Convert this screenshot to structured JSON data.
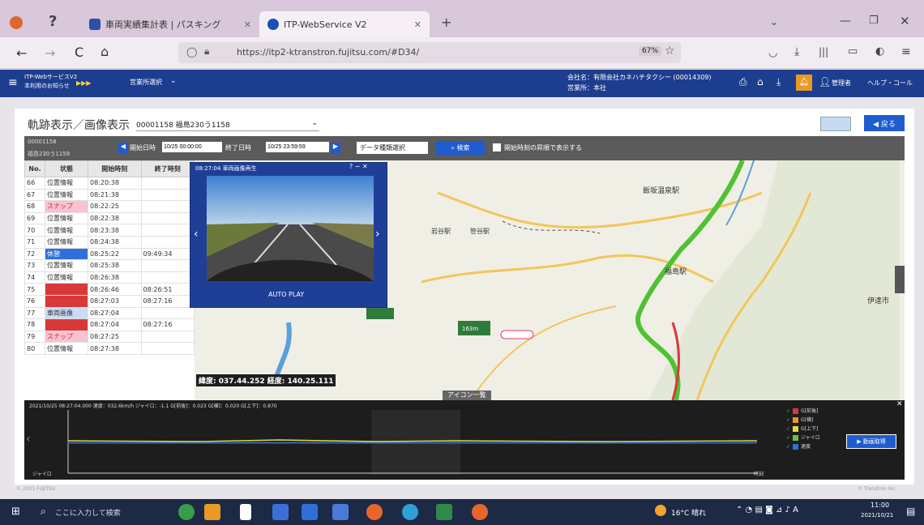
{
  "browser": {
    "tabs": [
      {
        "label": "車両実績集計表 | パスキング"
      },
      {
        "label": "ITP-WebService V2"
      }
    ],
    "url": "https://itp2-ktranstron.fujitsu.com/#D34/",
    "zoom": "67%"
  },
  "app_header": {
    "left_text_1": "ITP-WebサービスV2",
    "left_text_2": "本利用のお知らせ",
    "menu": "営業所選択",
    "company": "会社名：有限会社カネハチタクシー (00014309)",
    "office": "営業所：本社",
    "user": "管理者",
    "help": "ヘルプ・コール"
  },
  "page": {
    "title": "軌跡表示／画像表示",
    "vehicle_select": "00001158 福島230う1158",
    "back_button": "戻る"
  },
  "toolbar": {
    "vehicle_id": "00001158",
    "vehicle_plate": "福島230う1158",
    "start_label": "開始日時",
    "start_value": "10/25 00:00:00",
    "end_label": "終了日時",
    "end_value": "10/25 23:59:59",
    "data_select": "データ種類選択",
    "search": "検索",
    "checkbox_label": "開始時刻の昇順で表示する"
  },
  "table": {
    "headers": [
      "No.",
      "状態",
      "開始時刻",
      "終了時刻"
    ],
    "rows": [
      {
        "no": "66",
        "status": "位置情報",
        "start": "08:20:38",
        "end": "",
        "color": ""
      },
      {
        "no": "67",
        "status": "位置情報",
        "start": "08:21:38",
        "end": "",
        "color": ""
      },
      {
        "no": "68",
        "status": "スナップ",
        "start": "08:22:25",
        "end": "",
        "color": "#f7c3d3"
      },
      {
        "no": "69",
        "status": "位置情報",
        "start": "08:22:38",
        "end": "",
        "color": ""
      },
      {
        "no": "70",
        "status": "位置情報",
        "start": "08:23:38",
        "end": "",
        "color": ""
      },
      {
        "no": "71",
        "status": "位置情報",
        "start": "08:24:38",
        "end": "",
        "color": ""
      },
      {
        "no": "72",
        "status": "休憩",
        "start": "08:25:22",
        "end": "09:49:34",
        "color": "#2f6fd8"
      },
      {
        "no": "73",
        "status": "位置情報",
        "start": "08:25:38",
        "end": "",
        "color": ""
      },
      {
        "no": "74",
        "status": "位置情報",
        "start": "08:26:38",
        "end": "",
        "color": ""
      },
      {
        "no": "75",
        "status": "",
        "start": "08:26:46",
        "end": "08:26:51",
        "color": "#d93838"
      },
      {
        "no": "76",
        "status": "",
        "start": "08:27:03",
        "end": "08:27:16",
        "color": "#d93838"
      },
      {
        "no": "77",
        "status": "車両画像",
        "start": "08:27:04",
        "end": "",
        "color": "#c9dcf5"
      },
      {
        "no": "78",
        "status": "",
        "start": "08:27:04",
        "end": "08:27:16",
        "color": "#d93838"
      },
      {
        "no": "79",
        "status": "スナップ",
        "start": "08:27:25",
        "end": "",
        "color": "#f7c3d3"
      },
      {
        "no": "80",
        "status": "位置情報",
        "start": "08:27:38",
        "end": "",
        "color": ""
      }
    ]
  },
  "popup": {
    "title": "08:27:04 車両画像再生",
    "play_label": "AUTO PLAY"
  },
  "map": {
    "labels": [
      "飯坂温泉駅",
      "福島駅",
      "伊達市",
      "岩谷駅",
      "笹谷駅"
    ],
    "coord_text": "緯度: 037.44.252  経度: 140.25.111",
    "icon_label": "アイコン一覧",
    "elevation": "163m"
  },
  "chart": {
    "header_text": "2021/10/25 08:27:04.000 速度：032.6km/h ジャイロ：-1.1 G[前後]：0.023 G[横]：0.020 G[上下]：0.870",
    "legend": [
      "G[前後]",
      "G[横]",
      "G[上下]",
      "ジャイロ",
      "速度"
    ],
    "legend_colors": [
      "#d93838",
      "#e8932b",
      "#e9d83a",
      "#6cc04a",
      "#2f6fd8"
    ],
    "button": "動画取得",
    "ylabel_left": "ジャイロ",
    "xlabel_right": "時刻"
  },
  "status_bar": {
    "left": "© 2021 FUJITSU",
    "right": "© Transtron Inc."
  },
  "taskbar": {
    "search_placeholder": "ここに入力して検索",
    "weather": "16°C 晴れ",
    "time": "11:00",
    "date": "2021/10/21"
  }
}
